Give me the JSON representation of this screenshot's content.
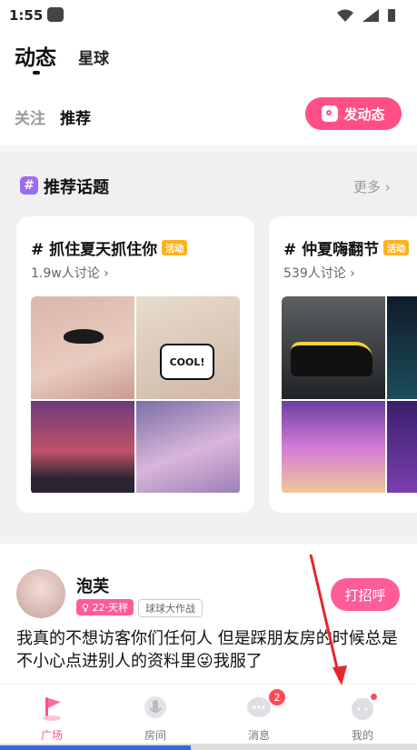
{
  "status_bar": {
    "time": "1:55"
  },
  "header": {
    "tabs": [
      {
        "label": "动态",
        "active": true
      },
      {
        "label": "星球",
        "active": false
      }
    ],
    "sub_tabs": [
      {
        "label": "关注",
        "active": false
      },
      {
        "label": "推荐",
        "active": true
      }
    ],
    "post_button": "发动态"
  },
  "topics": {
    "title": "推荐话题",
    "more": "更多",
    "cards": [
      {
        "title": "# 抓住夏天抓住你",
        "badge": "活动",
        "subtitle": "1.9w人讨论",
        "bubble_text": "COOL!"
      },
      {
        "title": "# 仲夏嗨翻节",
        "badge": "活动",
        "subtitle": "539人讨论"
      }
    ]
  },
  "post": {
    "username": "泡芙",
    "zodiac_tag": "22·天秤",
    "game_tag": "球球大作战",
    "greet_button": "打招呼",
    "text": "我真的不想访客你们任何人 但是踩朋友房的时候总是不小心点进别人的资料里😜我服了"
  },
  "nav": {
    "items": [
      {
        "label": "广场",
        "icon": "flag-icon",
        "active": true
      },
      {
        "label": "房间",
        "icon": "mic-icon",
        "active": false
      },
      {
        "label": "消息",
        "icon": "chat-icon",
        "active": false,
        "badge": "2"
      },
      {
        "label": "我的",
        "icon": "profile-icon",
        "active": false,
        "dot": true
      }
    ]
  },
  "colors": {
    "accent": "#ff4f86",
    "badge": "#ffb21e",
    "topic_icon": "#9a6cf0"
  }
}
